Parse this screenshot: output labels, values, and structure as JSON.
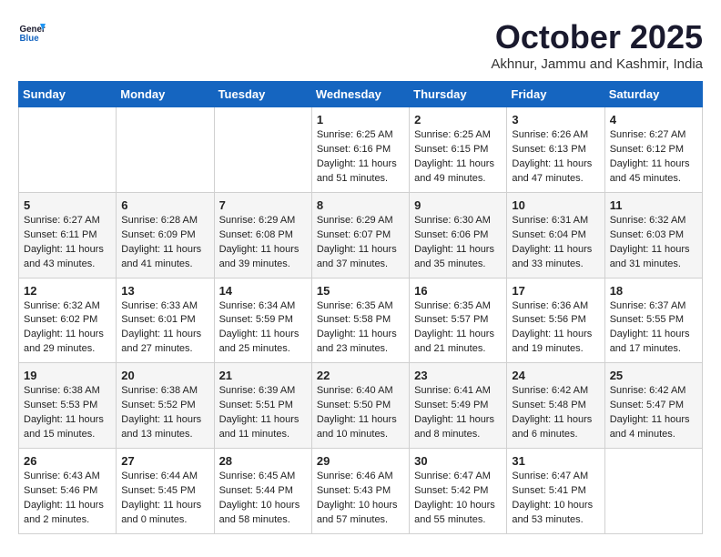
{
  "header": {
    "logo_line1": "General",
    "logo_line2": "Blue",
    "month": "October 2025",
    "location": "Akhnur, Jammu and Kashmir, India"
  },
  "days_of_week": [
    "Sunday",
    "Monday",
    "Tuesday",
    "Wednesday",
    "Thursday",
    "Friday",
    "Saturday"
  ],
  "weeks": [
    [
      {
        "day": "",
        "sunrise": "",
        "sunset": "",
        "daylight": ""
      },
      {
        "day": "",
        "sunrise": "",
        "sunset": "",
        "daylight": ""
      },
      {
        "day": "",
        "sunrise": "",
        "sunset": "",
        "daylight": ""
      },
      {
        "day": "1",
        "sunrise": "Sunrise: 6:25 AM",
        "sunset": "Sunset: 6:16 PM",
        "daylight": "Daylight: 11 hours and 51 minutes."
      },
      {
        "day": "2",
        "sunrise": "Sunrise: 6:25 AM",
        "sunset": "Sunset: 6:15 PM",
        "daylight": "Daylight: 11 hours and 49 minutes."
      },
      {
        "day": "3",
        "sunrise": "Sunrise: 6:26 AM",
        "sunset": "Sunset: 6:13 PM",
        "daylight": "Daylight: 11 hours and 47 minutes."
      },
      {
        "day": "4",
        "sunrise": "Sunrise: 6:27 AM",
        "sunset": "Sunset: 6:12 PM",
        "daylight": "Daylight: 11 hours and 45 minutes."
      }
    ],
    [
      {
        "day": "5",
        "sunrise": "Sunrise: 6:27 AM",
        "sunset": "Sunset: 6:11 PM",
        "daylight": "Daylight: 11 hours and 43 minutes."
      },
      {
        "day": "6",
        "sunrise": "Sunrise: 6:28 AM",
        "sunset": "Sunset: 6:09 PM",
        "daylight": "Daylight: 11 hours and 41 minutes."
      },
      {
        "day": "7",
        "sunrise": "Sunrise: 6:29 AM",
        "sunset": "Sunset: 6:08 PM",
        "daylight": "Daylight: 11 hours and 39 minutes."
      },
      {
        "day": "8",
        "sunrise": "Sunrise: 6:29 AM",
        "sunset": "Sunset: 6:07 PM",
        "daylight": "Daylight: 11 hours and 37 minutes."
      },
      {
        "day": "9",
        "sunrise": "Sunrise: 6:30 AM",
        "sunset": "Sunset: 6:06 PM",
        "daylight": "Daylight: 11 hours and 35 minutes."
      },
      {
        "day": "10",
        "sunrise": "Sunrise: 6:31 AM",
        "sunset": "Sunset: 6:04 PM",
        "daylight": "Daylight: 11 hours and 33 minutes."
      },
      {
        "day": "11",
        "sunrise": "Sunrise: 6:32 AM",
        "sunset": "Sunset: 6:03 PM",
        "daylight": "Daylight: 11 hours and 31 minutes."
      }
    ],
    [
      {
        "day": "12",
        "sunrise": "Sunrise: 6:32 AM",
        "sunset": "Sunset: 6:02 PM",
        "daylight": "Daylight: 11 hours and 29 minutes."
      },
      {
        "day": "13",
        "sunrise": "Sunrise: 6:33 AM",
        "sunset": "Sunset: 6:01 PM",
        "daylight": "Daylight: 11 hours and 27 minutes."
      },
      {
        "day": "14",
        "sunrise": "Sunrise: 6:34 AM",
        "sunset": "Sunset: 5:59 PM",
        "daylight": "Daylight: 11 hours and 25 minutes."
      },
      {
        "day": "15",
        "sunrise": "Sunrise: 6:35 AM",
        "sunset": "Sunset: 5:58 PM",
        "daylight": "Daylight: 11 hours and 23 minutes."
      },
      {
        "day": "16",
        "sunrise": "Sunrise: 6:35 AM",
        "sunset": "Sunset: 5:57 PM",
        "daylight": "Daylight: 11 hours and 21 minutes."
      },
      {
        "day": "17",
        "sunrise": "Sunrise: 6:36 AM",
        "sunset": "Sunset: 5:56 PM",
        "daylight": "Daylight: 11 hours and 19 minutes."
      },
      {
        "day": "18",
        "sunrise": "Sunrise: 6:37 AM",
        "sunset": "Sunset: 5:55 PM",
        "daylight": "Daylight: 11 hours and 17 minutes."
      }
    ],
    [
      {
        "day": "19",
        "sunrise": "Sunrise: 6:38 AM",
        "sunset": "Sunset: 5:53 PM",
        "daylight": "Daylight: 11 hours and 15 minutes."
      },
      {
        "day": "20",
        "sunrise": "Sunrise: 6:38 AM",
        "sunset": "Sunset: 5:52 PM",
        "daylight": "Daylight: 11 hours and 13 minutes."
      },
      {
        "day": "21",
        "sunrise": "Sunrise: 6:39 AM",
        "sunset": "Sunset: 5:51 PM",
        "daylight": "Daylight: 11 hours and 11 minutes."
      },
      {
        "day": "22",
        "sunrise": "Sunrise: 6:40 AM",
        "sunset": "Sunset: 5:50 PM",
        "daylight": "Daylight: 11 hours and 10 minutes."
      },
      {
        "day": "23",
        "sunrise": "Sunrise: 6:41 AM",
        "sunset": "Sunset: 5:49 PM",
        "daylight": "Daylight: 11 hours and 8 minutes."
      },
      {
        "day": "24",
        "sunrise": "Sunrise: 6:42 AM",
        "sunset": "Sunset: 5:48 PM",
        "daylight": "Daylight: 11 hours and 6 minutes."
      },
      {
        "day": "25",
        "sunrise": "Sunrise: 6:42 AM",
        "sunset": "Sunset: 5:47 PM",
        "daylight": "Daylight: 11 hours and 4 minutes."
      }
    ],
    [
      {
        "day": "26",
        "sunrise": "Sunrise: 6:43 AM",
        "sunset": "Sunset: 5:46 PM",
        "daylight": "Daylight: 11 hours and 2 minutes."
      },
      {
        "day": "27",
        "sunrise": "Sunrise: 6:44 AM",
        "sunset": "Sunset: 5:45 PM",
        "daylight": "Daylight: 11 hours and 0 minutes."
      },
      {
        "day": "28",
        "sunrise": "Sunrise: 6:45 AM",
        "sunset": "Sunset: 5:44 PM",
        "daylight": "Daylight: 10 hours and 58 minutes."
      },
      {
        "day": "29",
        "sunrise": "Sunrise: 6:46 AM",
        "sunset": "Sunset: 5:43 PM",
        "daylight": "Daylight: 10 hours and 57 minutes."
      },
      {
        "day": "30",
        "sunrise": "Sunrise: 6:47 AM",
        "sunset": "Sunset: 5:42 PM",
        "daylight": "Daylight: 10 hours and 55 minutes."
      },
      {
        "day": "31",
        "sunrise": "Sunrise: 6:47 AM",
        "sunset": "Sunset: 5:41 PM",
        "daylight": "Daylight: 10 hours and 53 minutes."
      },
      {
        "day": "",
        "sunrise": "",
        "sunset": "",
        "daylight": ""
      }
    ]
  ]
}
